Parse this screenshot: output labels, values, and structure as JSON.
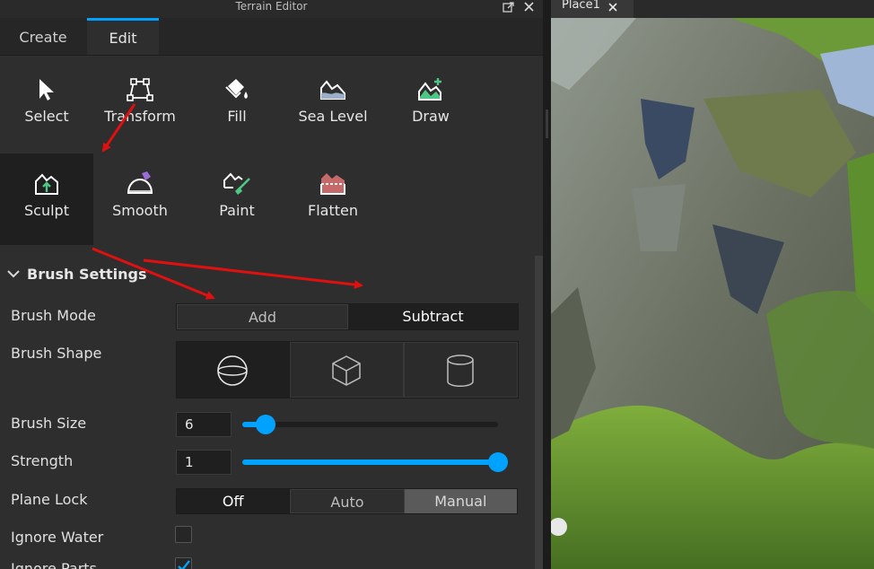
{
  "window": {
    "title": "Terrain Editor"
  },
  "tabs": [
    {
      "label": "Create",
      "active": false
    },
    {
      "label": "Edit",
      "active": true
    }
  ],
  "tools": [
    {
      "label": "Select",
      "icon": "select-arrow-icon"
    },
    {
      "label": "Transform",
      "icon": "transform-icon"
    },
    {
      "label": "Fill",
      "icon": "fill-bucket-icon"
    },
    {
      "label": "Sea Level",
      "icon": "sea-level-icon"
    },
    {
      "label": "Draw",
      "icon": "draw-terrain-icon"
    },
    {
      "label": "Sculpt",
      "icon": "sculpt-icon",
      "active": true
    },
    {
      "label": "Smooth",
      "icon": "smooth-icon"
    },
    {
      "label": "Paint",
      "icon": "paint-brush-icon"
    },
    {
      "label": "Flatten",
      "icon": "flatten-icon"
    }
  ],
  "brush_settings": {
    "header": "Brush Settings",
    "brush_mode": {
      "label": "Brush Mode",
      "options": [
        "Add",
        "Subtract"
      ],
      "selected": "Subtract"
    },
    "brush_shape": {
      "label": "Brush Shape",
      "options": [
        "sphere-icon",
        "cube-icon",
        "cylinder-icon"
      ],
      "selected": "sphere-icon"
    },
    "brush_size": {
      "label": "Brush Size",
      "value": "6",
      "slider_fraction": 0.09
    },
    "strength": {
      "label": "Strength",
      "value": "1",
      "slider_fraction": 1.0
    },
    "plane_lock": {
      "label": "Plane Lock",
      "options": [
        "Off",
        "Auto",
        "Manual"
      ],
      "selected": "Off"
    },
    "ignore_water": {
      "label": "Ignore Water",
      "checked": false
    },
    "ignore_parts": {
      "label": "Ignore Parts",
      "checked": true
    }
  },
  "viewport": {
    "tab_label": "Place1"
  },
  "colors": {
    "accent": "#00a2ff",
    "panel_bg": "#2e2e2e",
    "annotation_arrow": "#e01010"
  }
}
